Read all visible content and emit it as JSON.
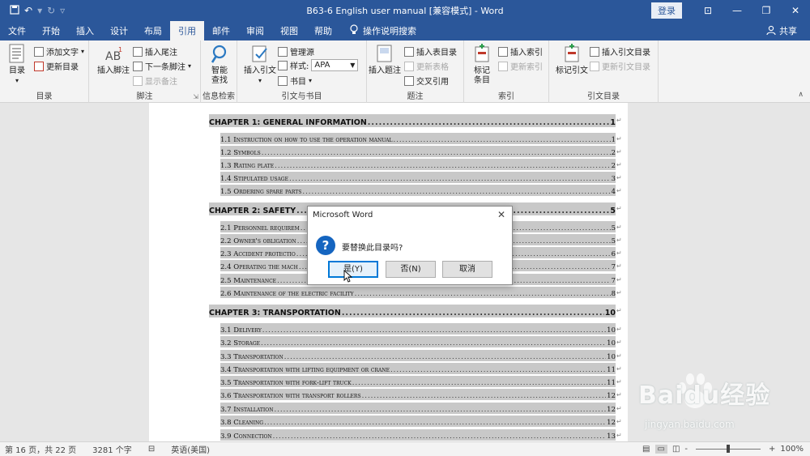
{
  "titlebar": {
    "title": "B63-6 English user manual [兼容模式] - Word",
    "login": "登录",
    "icons": [
      "save-icon",
      "undo-icon",
      "redo-icon",
      "customize-qat-icon",
      "ribbon-display-icon",
      "minimize-icon",
      "restore-icon",
      "close-icon"
    ]
  },
  "tabs": [
    "文件",
    "开始",
    "插入",
    "设计",
    "布局",
    "引用",
    "邮件",
    "审阅",
    "视图",
    "帮助"
  ],
  "active_tab": "引用",
  "tell_me": "操作说明搜索",
  "share": "共享",
  "ribbon": {
    "toc": {
      "big": "目录",
      "add_text": "添加文字",
      "update_toc": "更新目录",
      "label": "目录"
    },
    "footnotes": {
      "insert_footnote": "插入脚注",
      "insert_endnote": "插入尾注",
      "next_footnote": "下一条脚注",
      "show_notes": "显示备注",
      "label": "脚注"
    },
    "research": {
      "smart_lookup_1": "智能",
      "smart_lookup_2": "查找",
      "label": "信息检索"
    },
    "citations": {
      "insert_citation": "插入引文",
      "manage_sources": "管理源",
      "style_label": "样式:",
      "style_value": "APA",
      "bibliography": "书目",
      "label": "引文与书目"
    },
    "captions": {
      "insert_caption": "插入题注",
      "insert_tof": "插入表目录",
      "update_table": "更新表格",
      "cross_reference": "交叉引用",
      "label": "题注"
    },
    "index": {
      "mark_entry_1": "标记",
      "mark_entry_2": "条目",
      "insert_index": "插入索引",
      "update_index": "更新索引",
      "label": "索引"
    },
    "toa": {
      "mark_citation": "标记引文",
      "insert_toa": "插入引文目录",
      "update_toa": "更新引文目录",
      "label": "引文目录"
    }
  },
  "toc": [
    {
      "text": "CHAPTER 1: GENERAL INFORMATION",
      "page": "1",
      "level": 1
    },
    {
      "text": "1.1 Instruction on how to use the operation manual",
      "page": "1",
      "level": 2
    },
    {
      "text": "1.2 Symbols",
      "page": "2",
      "level": 2
    },
    {
      "text": "1.3 Rating plate",
      "page": "2",
      "level": 2
    },
    {
      "text": "1.4 Stipulated usage",
      "page": "3",
      "level": 2
    },
    {
      "text": "1.5 Ordering spare parts",
      "page": "4",
      "level": 2
    },
    {
      "text": "CHAPTER 2: SAFETY",
      "page": "5",
      "level": 1
    },
    {
      "text": "2.1 Personnel requirem",
      "page": "5",
      "level": 2
    },
    {
      "text": "2.2 Owner's obligation",
      "page": "5",
      "level": 2
    },
    {
      "text": "2.3 Accident protectio",
      "page": "6",
      "level": 2
    },
    {
      "text": "2.4 Operating the mach",
      "page": "7",
      "level": 2
    },
    {
      "text": "2.5 Maintenance",
      "page": "7",
      "level": 2
    },
    {
      "text": "2.6 Maintenance of the electric facility",
      "page": "8",
      "level": 2
    },
    {
      "text": "CHAPTER 3: TRANSPORTATION",
      "page": "10",
      "level": 1
    },
    {
      "text": "3.1 Delivery",
      "page": "10",
      "level": 2
    },
    {
      "text": "3.2 Storage",
      "page": "10",
      "level": 2
    },
    {
      "text": "3.3 Transportation",
      "page": "10",
      "level": 2
    },
    {
      "text": "3.4 Transportation with lifting equipment or crane",
      "page": "11",
      "level": 2
    },
    {
      "text": "3.5 Transportation with fork-lift truck",
      "page": "11",
      "level": 2
    },
    {
      "text": "3.6 Transportation with transport rollers",
      "page": "12",
      "level": 2
    },
    {
      "text": "3.7 Installation",
      "page": "12",
      "level": 2
    },
    {
      "text": "3.8 Cleaning",
      "page": "12",
      "level": 2
    },
    {
      "text": "3.9 Connection",
      "page": "13",
      "level": 2
    }
  ],
  "dialog": {
    "title": "Microsoft Word",
    "message": "要替换此目录吗?",
    "yes": "是(Y)",
    "no": "否(N)",
    "cancel": "取消"
  },
  "status": {
    "page": "第 16 页，共 22 页",
    "words": "3281 个字",
    "language": "英语(美国)",
    "zoom": "100%",
    "zoom_minus": "-",
    "zoom_plus": "+"
  },
  "watermark": {
    "text": "Baidu经验",
    "url": "jingyan.baidu.com"
  },
  "colors": {
    "accent": "#2b579a",
    "toc_highlight": "#c8c8c8",
    "dialog_icon": "#1565c0"
  }
}
